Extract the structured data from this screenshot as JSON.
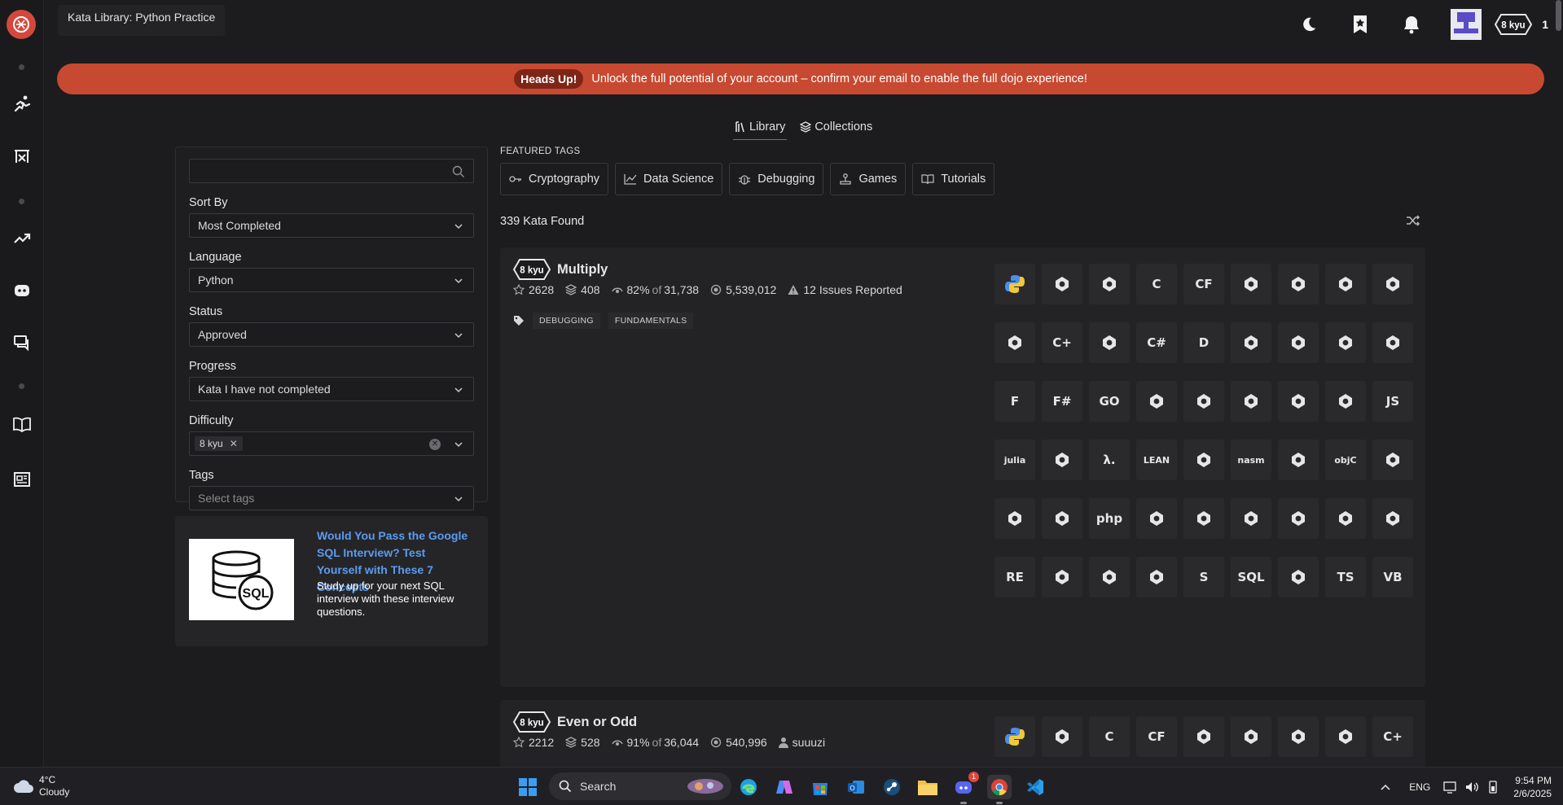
{
  "header": {
    "breadcrumb": "Kata Library: Python Practice",
    "honor": "1",
    "rank": "8 kyu"
  },
  "banner": {
    "pill": "Heads Up!",
    "message": "Unlock the full potential of your account – confirm your email to enable the full dojo experience!"
  },
  "tabs": [
    {
      "label": "Library",
      "active": true
    },
    {
      "label": "Collections",
      "active": false
    }
  ],
  "filters": {
    "search_value": "",
    "sort_by": {
      "label": "Sort By",
      "value": "Most Completed"
    },
    "language": {
      "label": "Language",
      "value": "Python"
    },
    "status": {
      "label": "Status",
      "value": "Approved"
    },
    "progress": {
      "label": "Progress",
      "value": "Kata I have not completed"
    },
    "difficulty": {
      "label": "Difficulty",
      "chip": "8 kyu"
    },
    "tags": {
      "label": "Tags",
      "placeholder": "Select tags"
    }
  },
  "promo": {
    "image_text": "SQL",
    "title": "Would You Pass the Google SQL Interview? Test Yourself with These 7 Concepts",
    "description": "Study up for your next SQL interview with these interview questions."
  },
  "featured": {
    "heading": "FEATURED TAGS",
    "tags": [
      "Cryptography",
      "Data Science",
      "Debugging",
      "Games",
      "Tutorials"
    ]
  },
  "results": {
    "count_text": "339 Kata Found"
  },
  "katas": [
    {
      "rank": "8 kyu",
      "name": "Multiply",
      "stars": "2628",
      "collections": "408",
      "satisfaction": "82%",
      "of_word": "of",
      "votes": "31,738",
      "completed": "5,539,012",
      "issues": "12 Issues Reported",
      "tags": [
        "DEBUGGING",
        "FUNDAMENTALS"
      ],
      "languages": [
        "python",
        "agda",
        "bf",
        "c",
        "cfml",
        "clojure",
        "coffeescript",
        "commonlisp",
        "crystal",
        "elixir",
        "cplusplus",
        "cobol",
        "csharp",
        "dart",
        "elm",
        "erlang",
        "factor",
        "forth",
        "fortran",
        "fsharp",
        "go",
        "groovy",
        "haskell",
        "haxe",
        "idris",
        "java",
        "javascript",
        "julia",
        "kotlin",
        "lambdacalc",
        "lean",
        "lua",
        "nasm",
        "nim",
        "objc",
        "ocaml",
        "pascal",
        "perl",
        "php",
        "powershell",
        "prolog",
        "purescript",
        "r",
        "racket",
        "raku",
        "reason",
        "rust",
        "scala",
        "shell",
        "solidity",
        "sql",
        "swift",
        "typescript",
        "vb"
      ],
      "language_glyphs": [
        "",
        "",
        "",
        "C",
        "CF",
        "",
        "",
        "",
        "",
        "",
        "C+",
        "",
        "C#",
        "D",
        "",
        "",
        "",
        "",
        "F",
        "F#",
        "GO",
        "",
        "",
        "",
        "",
        "",
        "JS",
        "julia",
        "",
        "λ.",
        "LEAN",
        "",
        "nasm",
        "",
        "objC",
        "",
        "",
        "",
        "php",
        "",
        "",
        "",
        "",
        "",
        "",
        "RE",
        "",
        "",
        "",
        "S",
        "SQL",
        "",
        "TS",
        "VB"
      ]
    },
    {
      "rank": "8 kyu",
      "name": "Even or Odd",
      "stars": "2212",
      "collections": "528",
      "satisfaction": "91%",
      "of_word": "of",
      "votes": "36,044",
      "completed": "540,996",
      "author": "suuuzi",
      "languages": [
        "python",
        "bf",
        "c",
        "cfml",
        "clojure",
        "coffeescript",
        "commonlisp",
        "crystal",
        "cplusplus"
      ],
      "language_glyphs": [
        "",
        "",
        "C",
        "CF",
        "",
        "",
        "",
        "",
        "C+"
      ]
    }
  ],
  "taskbar": {
    "temperature": "4°C",
    "condition": "Cloudy",
    "search_label": "Search",
    "language": "ENG",
    "time": "9:54 PM",
    "date": "2/6/2025",
    "discord_badge": "1"
  },
  "colors": {
    "accent": "#d3483d",
    "banner": "#c84931",
    "link": "#5a9cf0",
    "python": "#4d8ee8"
  }
}
